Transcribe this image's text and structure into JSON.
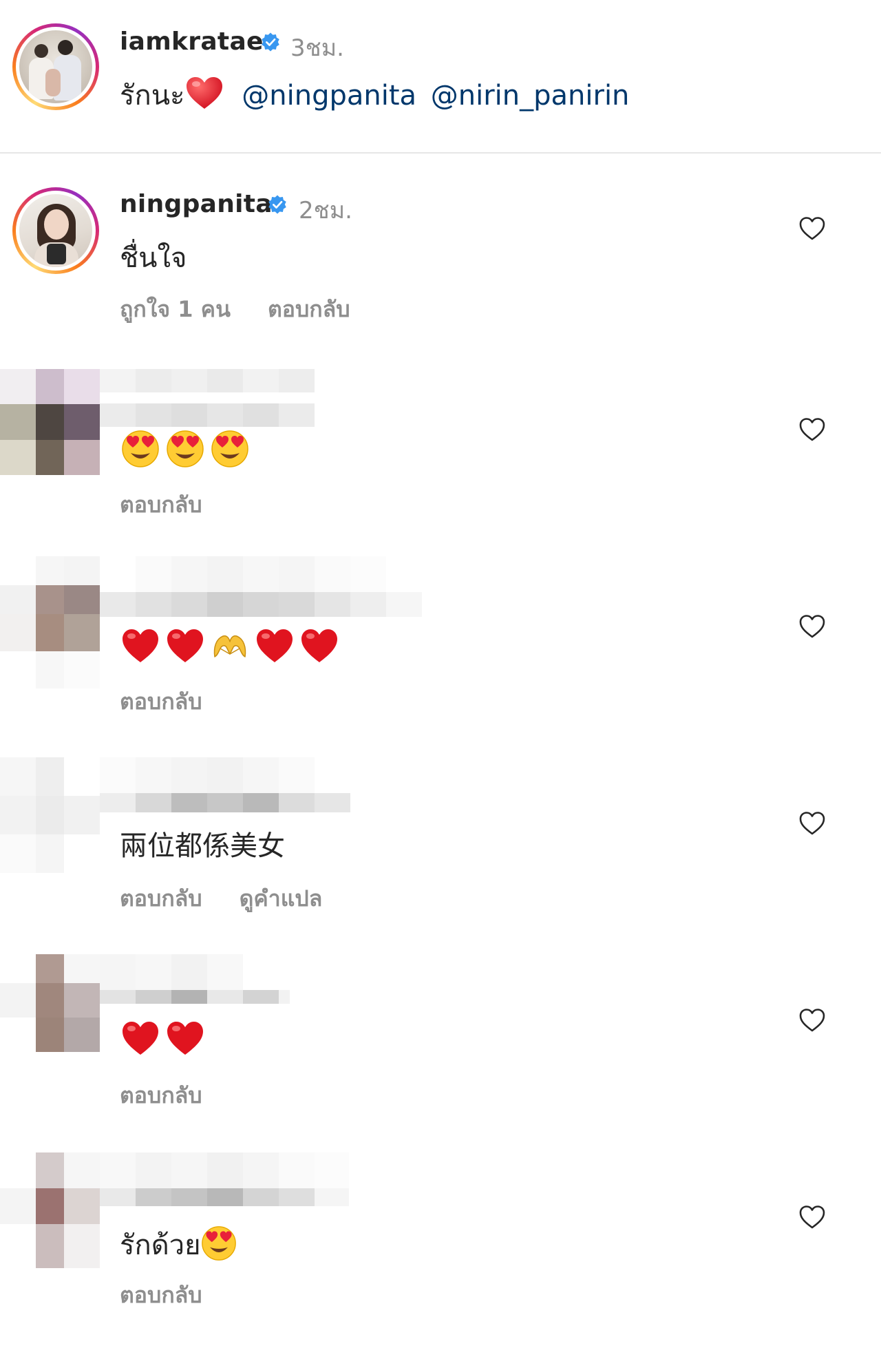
{
  "caption": {
    "username": "iamkratae",
    "verified": true,
    "time": "3ชม.",
    "text": "รักนะ",
    "mentions": [
      "@ningpanita",
      "@nirin_panirin"
    ]
  },
  "comments": [
    {
      "username": "ningpanita",
      "verified": true,
      "time": "2ชม.",
      "text": "ชื่นใจ",
      "likes": "ถูกใจ 1 คน",
      "reply": "ตอบกลับ"
    },
    {
      "username": "",
      "text": "",
      "emojis": [
        "heart-eyes",
        "heart-eyes",
        "heart-eyes"
      ],
      "reply": "ตอบกลับ"
    },
    {
      "username": "",
      "text": "",
      "emojis": [
        "red-heart",
        "red-heart",
        "heart-hands",
        "red-heart",
        "red-heart"
      ],
      "reply": "ตอบกลับ"
    },
    {
      "username": "",
      "text": "兩位都係美女",
      "reply": "ตอบกลับ",
      "translate": "ดูคำแปล"
    },
    {
      "username": "",
      "text": "",
      "emojis": [
        "red-heart",
        "red-heart"
      ],
      "reply": "ตอบกลับ"
    },
    {
      "username": "",
      "text": "รักด้วย",
      "emojis": [
        "heart-eyes"
      ],
      "reply": "ตอบกลับ"
    }
  ],
  "icons": {
    "verified": "verified-badge-icon",
    "like": "heart-outline-icon"
  },
  "colors": {
    "username": "#262626",
    "meta": "#8e8e8e",
    "mention": "#00376b",
    "verified": "#3897f0",
    "divider": "#e6e6e6"
  }
}
